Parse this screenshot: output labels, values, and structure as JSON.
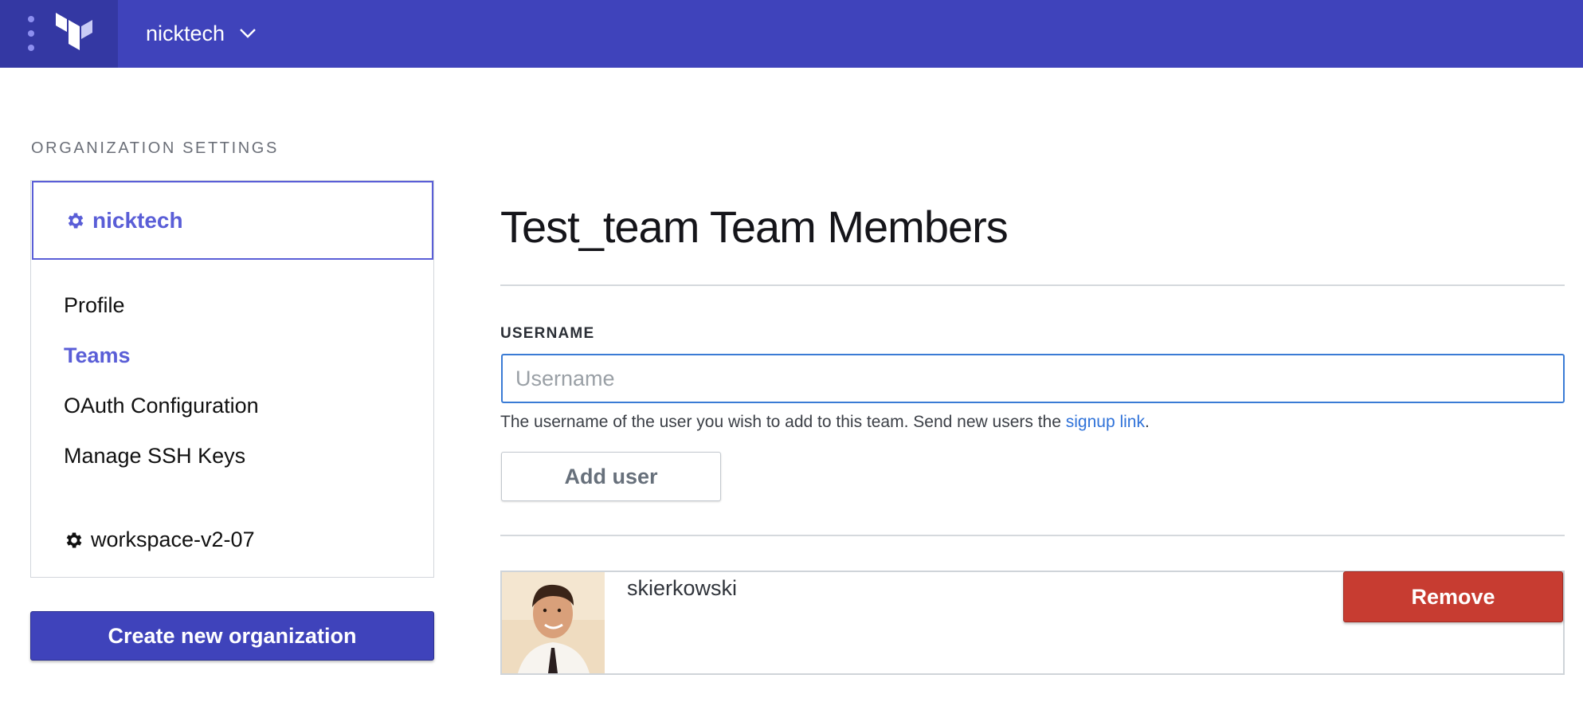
{
  "header": {
    "org_name": "nicktech",
    "menu_icon": "vertical-dots-icon",
    "logo_icon": "terraform-logo-icon",
    "dropdown_icon": "chevron-down-icon"
  },
  "sidebar": {
    "section_label": "ORGANIZATION SETTINGS",
    "current_org": "nicktech",
    "items": [
      {
        "label": "Profile",
        "active": false
      },
      {
        "label": "Teams",
        "active": true
      },
      {
        "label": "OAuth Configuration",
        "active": false
      },
      {
        "label": "Manage SSH Keys",
        "active": false
      }
    ],
    "workspace": "workspace-v2-07",
    "create_button": "Create new organization"
  },
  "main": {
    "title": "Test_team Team Members",
    "username_label": "USERNAME",
    "username_placeholder": "Username",
    "username_value": "",
    "help_text": "The username of the user you wish to add to this team. Send new users the ",
    "help_link": "signup link",
    "help_suffix": ".",
    "add_button": "Add user",
    "members": [
      {
        "username": "skierkowski",
        "remove_label": "Remove"
      }
    ]
  },
  "colors": {
    "nav_bg": "#3f43bb",
    "brand_bg": "#3438a3",
    "accent": "#5a5ed7",
    "danger": "#c73c31",
    "link": "#2f72d9"
  }
}
